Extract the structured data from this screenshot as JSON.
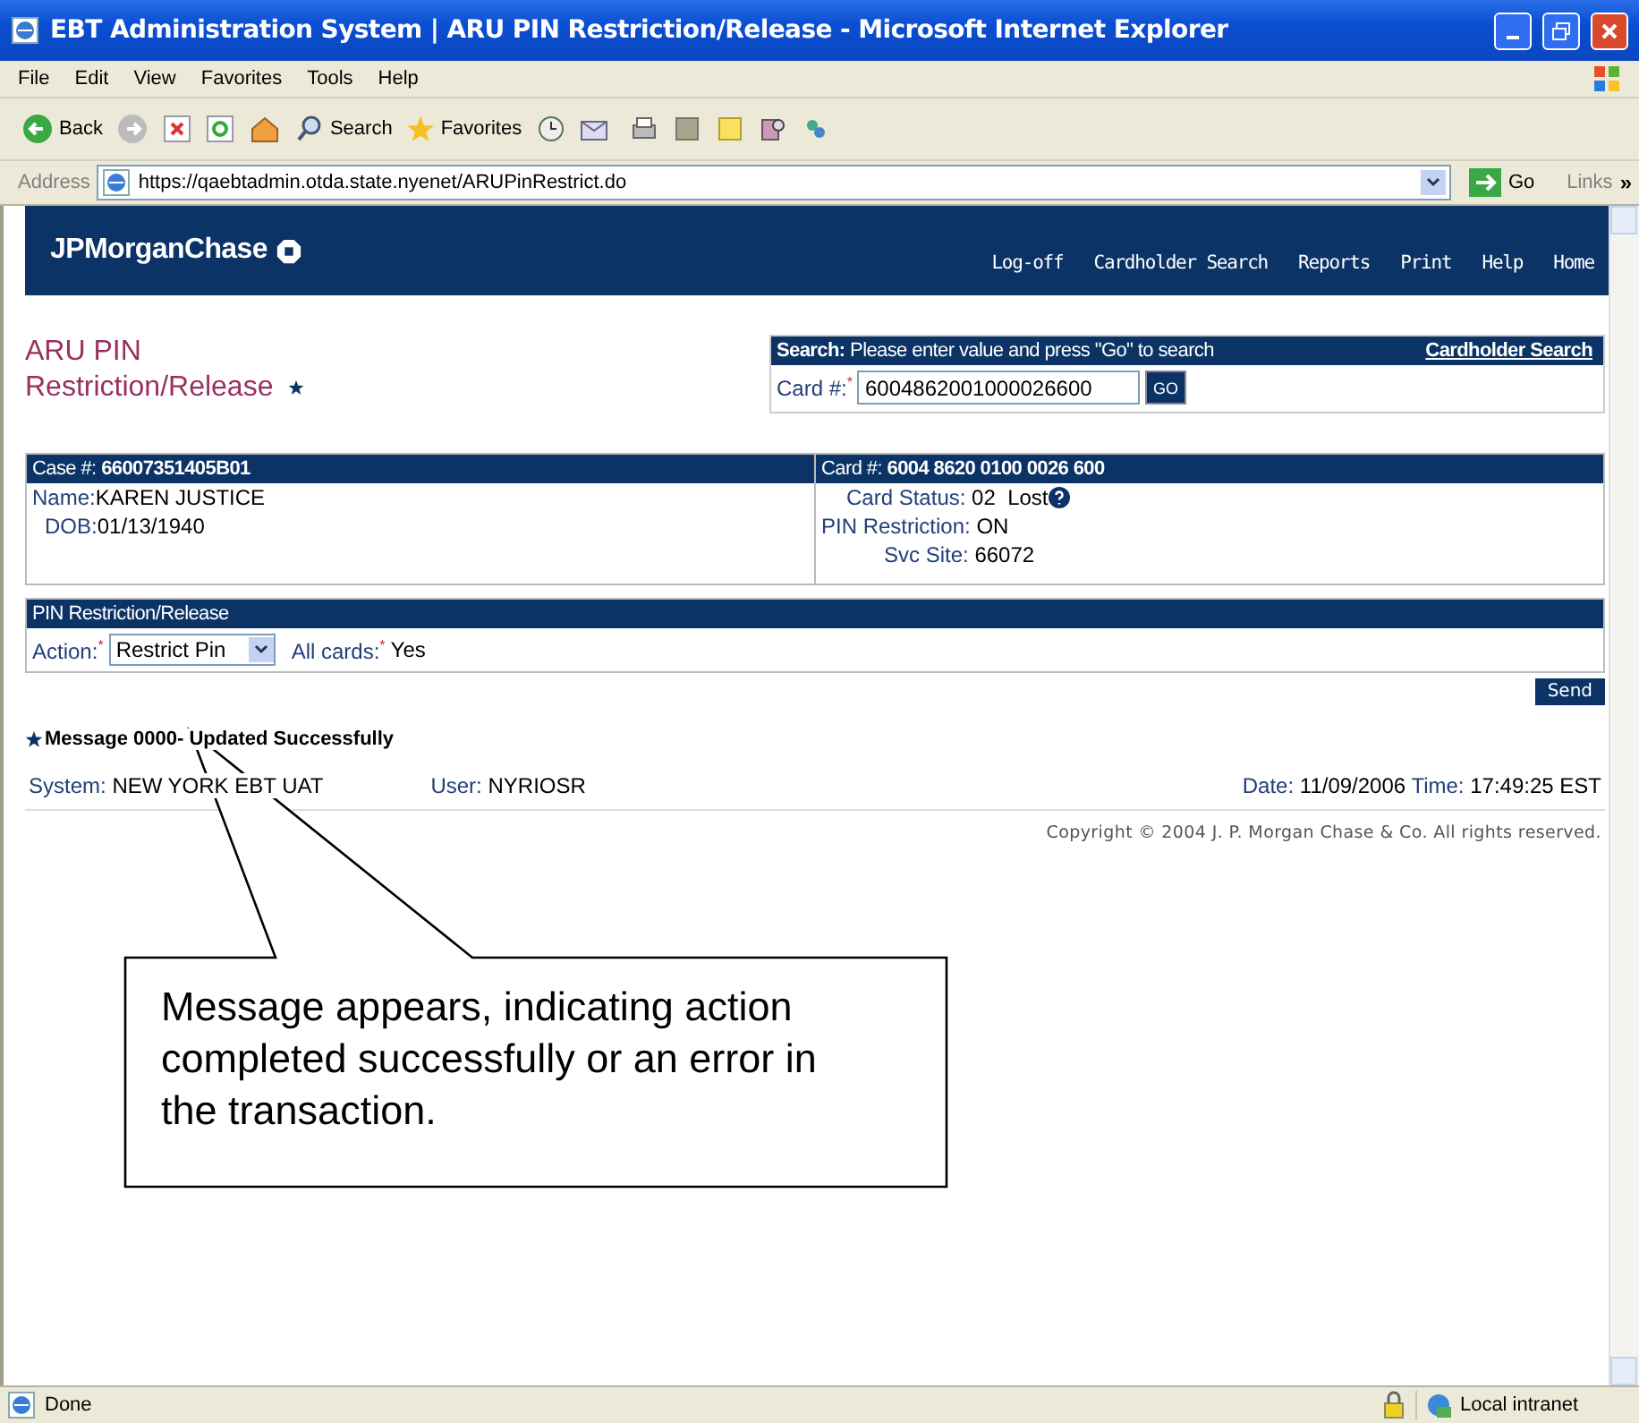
{
  "window": {
    "title": "EBT Administration System | ARU PIN Restriction/Release - Microsoft Internet Explorer"
  },
  "menu": [
    {
      "label": "File"
    },
    {
      "label": "Edit"
    },
    {
      "label": "View"
    },
    {
      "label": "Favorites"
    },
    {
      "label": "Tools"
    },
    {
      "label": "Help"
    }
  ],
  "toolbar": {
    "back": "Back",
    "search": "Search",
    "favorites": "Favorites"
  },
  "address": {
    "label": "Address",
    "url": "https://qaebtadmin.otda.state.nyenet/ARUPinRestrict.do",
    "go": "Go",
    "links": "Links",
    "more": "»"
  },
  "header": {
    "logo": "JPMorganChase",
    "nav": [
      "Log-off",
      "Cardholder Search",
      "Reports",
      "Print",
      "Help",
      "Home"
    ]
  },
  "page_title": "ARU PIN Restriction/Release",
  "search": {
    "heading": "Search:",
    "hint": "Please enter value and press \"Go\" to search",
    "link": "Cardholder Search",
    "field_label": "Card #:",
    "mark": "*",
    "value": "6004862001000026600",
    "button": "GO"
  },
  "case": {
    "label": "Case #:",
    "value": "66007351405B01",
    "name_label": "Name:",
    "name": "KAREN JUSTICE",
    "dob_label": "DOB:",
    "dob": "01/13/1940"
  },
  "card": {
    "label": "Card #:",
    "value": "6004 8620 0100 0026 600",
    "status_label": "Card Status:",
    "status": "02  Lost",
    "pin_label": "PIN Restriction:",
    "pin": "ON",
    "site_label": "Svc Site:",
    "site": "66072"
  },
  "pin_section": {
    "title": "PIN Restriction/Release",
    "action_label": "Action:",
    "action_mark": "*",
    "action": "Restrict Pin",
    "all_label": "All cards:",
    "all_mark": "*",
    "all": "Yes",
    "send": "Send"
  },
  "message": "Message 0000- Updated Successfully",
  "footer": {
    "system_label": "System:",
    "system": "NEW YORK EBT UAT",
    "user_label": "User:",
    "user": "NYRIOSR",
    "date_label": "Date:",
    "date": "11/09/2006",
    "time_label": "Time:",
    "time": "17:49:25 EST",
    "copyright": "Copyright © 2004 J. P. Morgan Chase & Co. All rights reserved."
  },
  "callout": "Message appears, indicating action completed successfully or an error in the transaction.",
  "status_bar": {
    "text": "Done",
    "zone": "Local intranet"
  }
}
